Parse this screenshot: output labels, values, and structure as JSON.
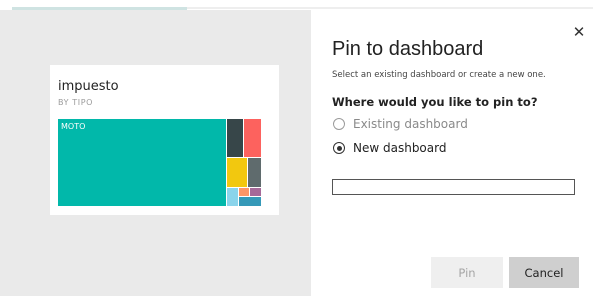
{
  "tile": {
    "title": "impuesto",
    "subtitle": "BY TIPO",
    "treemap": {
      "cells": [
        {
          "label": "MOTO",
          "color": "#01b8aa"
        },
        {
          "label": "",
          "color": "#374649"
        },
        {
          "label": "",
          "color": "#fd625e"
        },
        {
          "label": "",
          "color": "#f2c80f"
        },
        {
          "label": "",
          "color": "#5f6b6d"
        },
        {
          "label": "",
          "color": "#8ad4eb"
        },
        {
          "label": "",
          "color": "#fe9666"
        },
        {
          "label": "",
          "color": "#a66999"
        },
        {
          "label": "",
          "color": "#3599b8"
        }
      ]
    }
  },
  "dialog": {
    "close_glyph": "✕",
    "title": "Pin to dashboard",
    "help": "Select an existing dashboard or create a new one.",
    "question": "Where would you like to pin to?",
    "options": [
      {
        "label": "Existing dashboard",
        "selected": false,
        "disabled": true
      },
      {
        "label": "New dashboard",
        "selected": true,
        "disabled": false
      }
    ],
    "name_input": {
      "value": "",
      "placeholder": ""
    },
    "pin_label": "Pin",
    "cancel_label": "Cancel"
  }
}
